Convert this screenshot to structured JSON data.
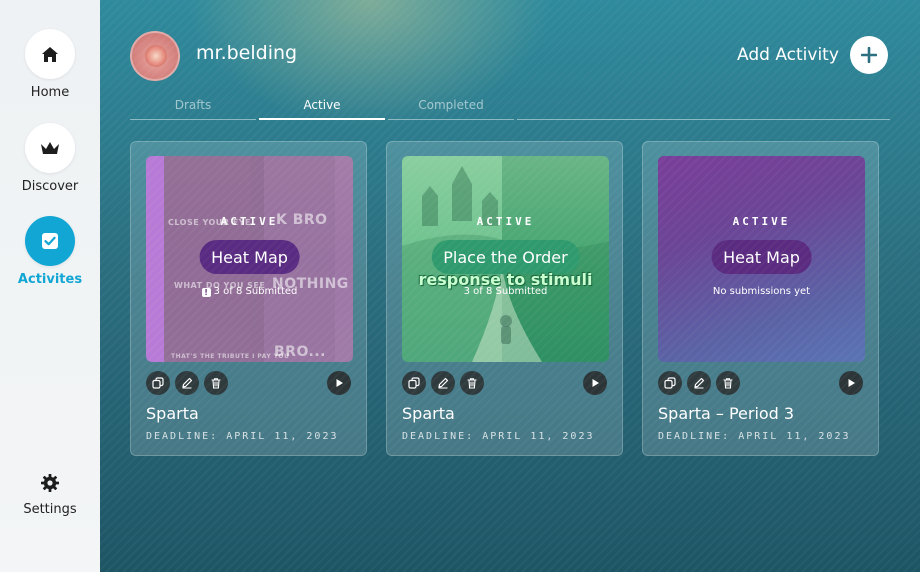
{
  "sidebar": {
    "items": [
      {
        "label": "Home",
        "icon": "house-icon"
      },
      {
        "label": "Discover",
        "icon": "crown-icon"
      },
      {
        "label": "Activites",
        "icon": "checkbox-icon"
      }
    ],
    "settings_label": "Settings"
  },
  "header": {
    "username": "mr.belding",
    "add_activity_label": "Add Activity"
  },
  "tabs": [
    {
      "label": "Drafts"
    },
    {
      "label": "Active"
    },
    {
      "label": "Completed"
    }
  ],
  "cards": [
    {
      "status": "ACTIVE",
      "activity_type": "Heat Map",
      "submissions": "3 of 8 Submitted",
      "title": "Sparta",
      "deadline": "DEADLINE: APRIL 11, 2023",
      "meme_top": "CLOSE YOUR EYE",
      "meme_top2": "K BRO",
      "meme_mid": "WHAT DO YOU SEE",
      "meme_mid2": "NOTHING",
      "meme_bottom": "THAT'S THE TRIBUTE I PAY YOU",
      "meme_bottom2": "BRO..."
    },
    {
      "status": "ACTIVE",
      "activity_type": "Place the Order",
      "overlay_text": "response to stimuli",
      "submissions": "3 of 8 Submitted",
      "title": "Sparta",
      "deadline": "DEADLINE: APRIL 11, 2023"
    },
    {
      "status": "ACTIVE",
      "activity_type": "Heat Map",
      "submissions": "No submissions yet",
      "title": "Sparta – Period 3",
      "deadline": "DEADLINE: APRIL 11, 2023"
    }
  ],
  "colors": {
    "accent": "#12a6d4",
    "sidebar_bg": "#eef2f4",
    "pill_purple": "#5a2b82",
    "pill_green": "#2f9a6d"
  }
}
